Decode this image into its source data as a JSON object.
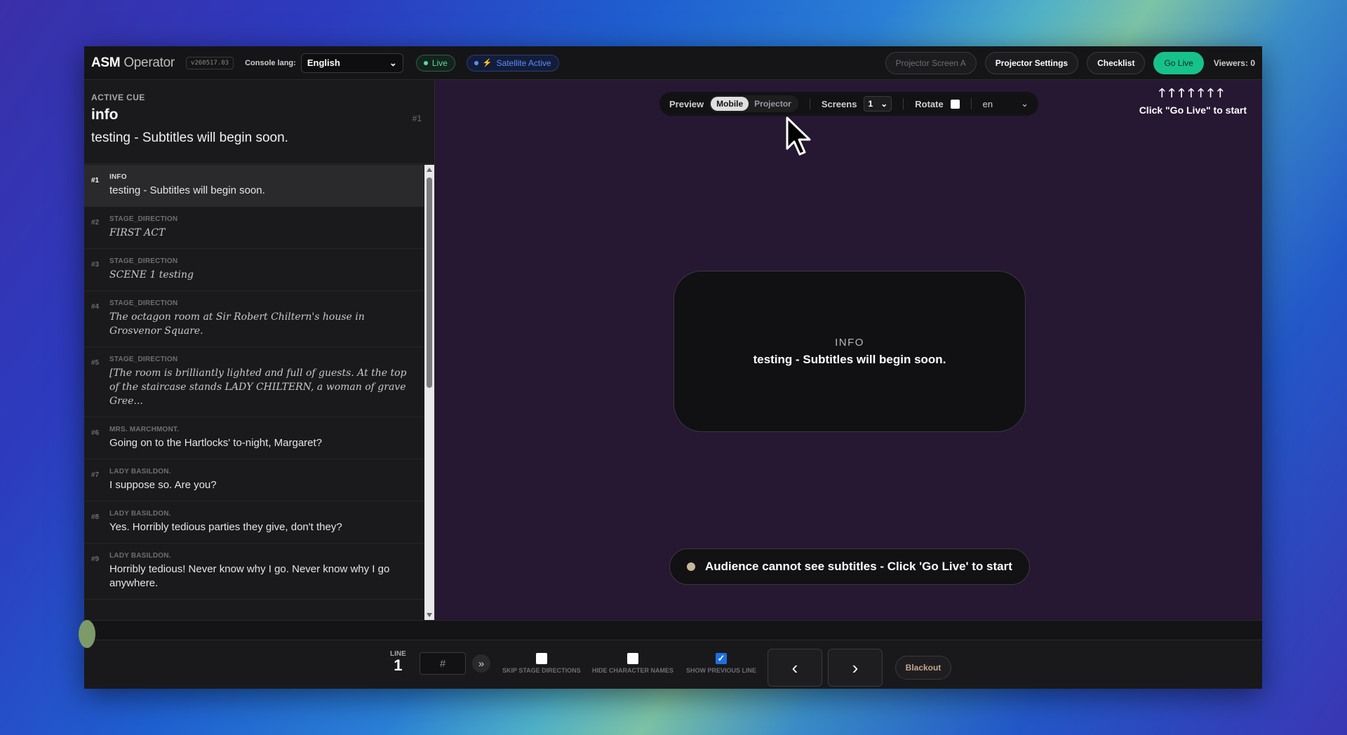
{
  "header": {
    "brand_strong": "ASM",
    "brand_light": "Operator",
    "version": "v260517.03",
    "console_lang_label": "Console lang:",
    "console_lang_value": "English",
    "live_label": "Live",
    "satellite_label": "Satellite Active",
    "projector_screen_label": "Projector Screen A",
    "projector_settings_label": "Projector Settings",
    "checklist_label": "Checklist",
    "go_live_label": "Go Live",
    "viewers_label": "Viewers:",
    "viewers_count": "0"
  },
  "active_cue": {
    "label": "ACTIVE CUE",
    "type": "info",
    "number": "#1",
    "text": "testing - Subtitles will begin soon."
  },
  "cues": [
    {
      "num": "#1",
      "type": "INFO",
      "text": "testing - Subtitles will begin soon.",
      "italic": false,
      "selected": true
    },
    {
      "num": "#2",
      "type": "STAGE_DIRECTION",
      "text": "FIRST ACT",
      "italic": true
    },
    {
      "num": "#3",
      "type": "STAGE_DIRECTION",
      "text": "SCENE 1 testing",
      "italic": true
    },
    {
      "num": "#4",
      "type": "STAGE_DIRECTION",
      "text": "The octagon room at Sir Robert Chiltern's house in Grosvenor Square.",
      "italic": true
    },
    {
      "num": "#5",
      "type": "STAGE_DIRECTION",
      "text": "[The room is brilliantly lighted and full of guests. At the top of the staircase stands LADY CHILTERN, a woman of grave Gree...",
      "italic": true
    },
    {
      "num": "#6",
      "type": "MRS. MARCHMONT.",
      "text": "Going on to the Hartlocks' to-night, Margaret?",
      "italic": false
    },
    {
      "num": "#7",
      "type": "LADY BASILDON.",
      "text": "I suppose so. Are you?",
      "italic": false
    },
    {
      "num": "#8",
      "type": "LADY BASILDON.",
      "text": "Yes. Horribly tedious parties they give, don't they?",
      "italic": false
    },
    {
      "num": "#9",
      "type": "LADY BASILDON.",
      "text": "Horribly tedious! Never know why I go. Never know why I go anywhere.",
      "italic": false
    }
  ],
  "preview_bar": {
    "preview_label": "Preview",
    "mobile_label": "Mobile",
    "projector_label": "Projector",
    "screens_label": "Screens",
    "screens_value": "1",
    "rotate_label": "Rotate",
    "lang_value": "en"
  },
  "hint": {
    "arrows": "🡑🡑🡑🡑🡑🡑🡑",
    "text": "Click \"Go Live\" to start"
  },
  "preview_card": {
    "type": "INFO",
    "text": "testing - Subtitles will begin soon."
  },
  "audience_status": "Audience cannot see subtitles - Click 'Go Live' to start",
  "bottom": {
    "line_label": "LINE",
    "line_value": "1",
    "hash_placeholder": "#",
    "skip_label": "SKIP STAGE DIRECTIONS",
    "hide_label": "HIDE CHARACTER NAMES",
    "show_prev_label": "SHOW PREVIOUS LINE",
    "prev_glyph": "‹",
    "next_glyph": "›",
    "blackout_label": "Blackout"
  },
  "colors": {
    "accent_green": "#17c28a",
    "live_green": "#5fd8a0",
    "satellite_blue": "#5b8dff",
    "preview_bg": "#261732"
  }
}
